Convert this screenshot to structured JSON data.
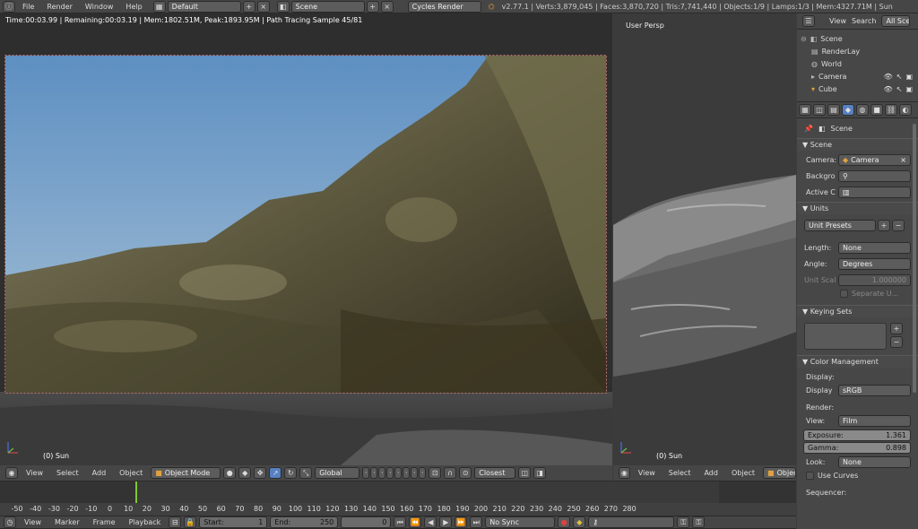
{
  "topbar": {
    "menus": [
      "File",
      "Render",
      "Window",
      "Help"
    ],
    "layout": "Default",
    "scene": "Scene",
    "engine": "Cycles Render",
    "stats": "v2.77.1 | Verts:3,879,045 | Faces:3,870,720 | Tris:7,741,440 | Objects:1/9 | Lamps:1/3 | Mem:4327.71M | Sun"
  },
  "render_view": {
    "status": "Time:00:03.99 | Remaining:00:03.19 | Mem:1802.51M, Peak:1893.95M | Path Tracing Sample 45/81",
    "object_label": "(0) Sun"
  },
  "right_view": {
    "title": "User Persp",
    "object_label": "(0) Sun"
  },
  "view_header_left": {
    "menus": [
      "View",
      "Select",
      "Add",
      "Object"
    ],
    "mode": "Object Mode",
    "orientation": "Global",
    "snap": "Closest"
  },
  "view_header_right": {
    "menus": [
      "View",
      "Select",
      "Add",
      "Object"
    ],
    "mode": "Objec"
  },
  "outliner": {
    "tabs": [
      "View",
      "Search",
      "All Sce"
    ],
    "items": [
      "Scene",
      "RenderLay",
      "World",
      "Camera",
      "Cube"
    ]
  },
  "properties": {
    "breadcrumb": "Scene",
    "scene_panel": {
      "title": "Scene",
      "camera_label": "Camera:",
      "camera_value": "Camera",
      "background_label": "Backgro",
      "active_label": "Active C"
    },
    "units_panel": {
      "title": "Units",
      "presets": "Unit Presets",
      "length_label": "Length:",
      "length_value": "None",
      "angle_label": "Angle:",
      "angle_value": "Degrees",
      "unit_scale_label": "Unit Scal",
      "unit_scale_value": "1.000000",
      "separate_label": "Separate U..."
    },
    "keying_panel": {
      "title": "Keying Sets"
    },
    "color_panel": {
      "title": "Color Management",
      "display_heading": "Display:",
      "display_label": "Display",
      "display_value": "sRGB",
      "render_heading": "Render:",
      "view_label": "View:",
      "view_value": "Film",
      "exposure_label": "Exposure:",
      "exposure_value": "1.361",
      "gamma_label": "Gamma:",
      "gamma_value": "0.898",
      "look_label": "Look:",
      "look_value": "None",
      "use_curves_label": "Use Curves",
      "sequencer_heading": "Sequencer:"
    }
  },
  "timeline": {
    "ticks": [
      "-50",
      "-40",
      "-30",
      "-20",
      "-10",
      "0",
      "10",
      "20",
      "30",
      "40",
      "50",
      "60",
      "70",
      "80",
      "90",
      "100",
      "110",
      "120",
      "130",
      "140",
      "150",
      "160",
      "170",
      "180",
      "190",
      "200",
      "210",
      "220",
      "230",
      "240",
      "250",
      "260",
      "270",
      "280"
    ],
    "menus": [
      "View",
      "Marker",
      "Frame",
      "Playback"
    ],
    "start_label": "Start:",
    "start_value": "1",
    "end_label": "End:",
    "end_value": "250",
    "current_frame": "0",
    "sync": "No Sync"
  },
  "colors": {
    "accent": "#5680c2",
    "playhead": "#7ec832"
  }
}
